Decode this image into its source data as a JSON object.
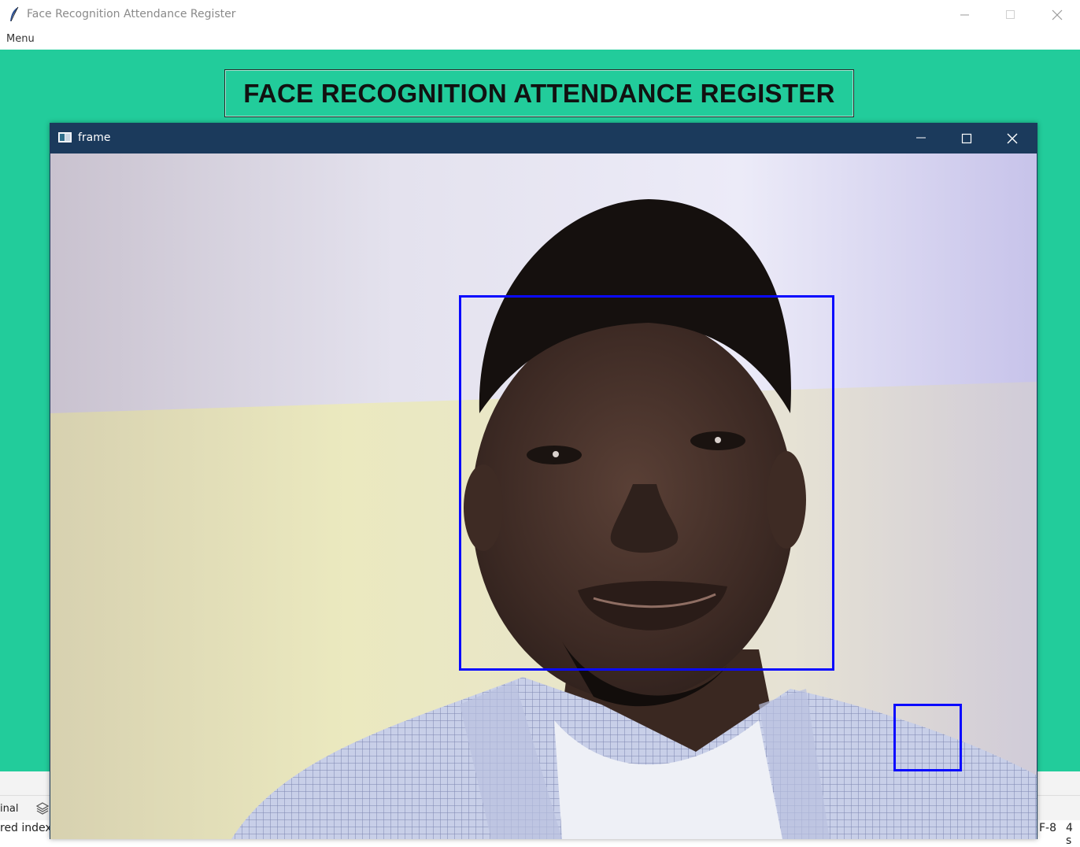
{
  "window": {
    "title": "Face Recognition Attendance Register",
    "controls": [
      "minimize",
      "maximize",
      "close"
    ]
  },
  "menubar": {
    "items": [
      "Menu"
    ]
  },
  "heading": {
    "text": "FACE RECOGNITION ATTENDANCE REGISTER"
  },
  "colors": {
    "background": "#22cc9b",
    "frame_titlebar": "#1b3a5c",
    "box": "#0a0aff"
  },
  "frame_window": {
    "title": "frame",
    "controls": [
      "minimize",
      "maximize",
      "close"
    ],
    "detections": 2
  },
  "background_ide": {
    "tab_text": "inal",
    "status_left": "red indexe",
    "encoding": "F-8",
    "indent": "4 s"
  }
}
